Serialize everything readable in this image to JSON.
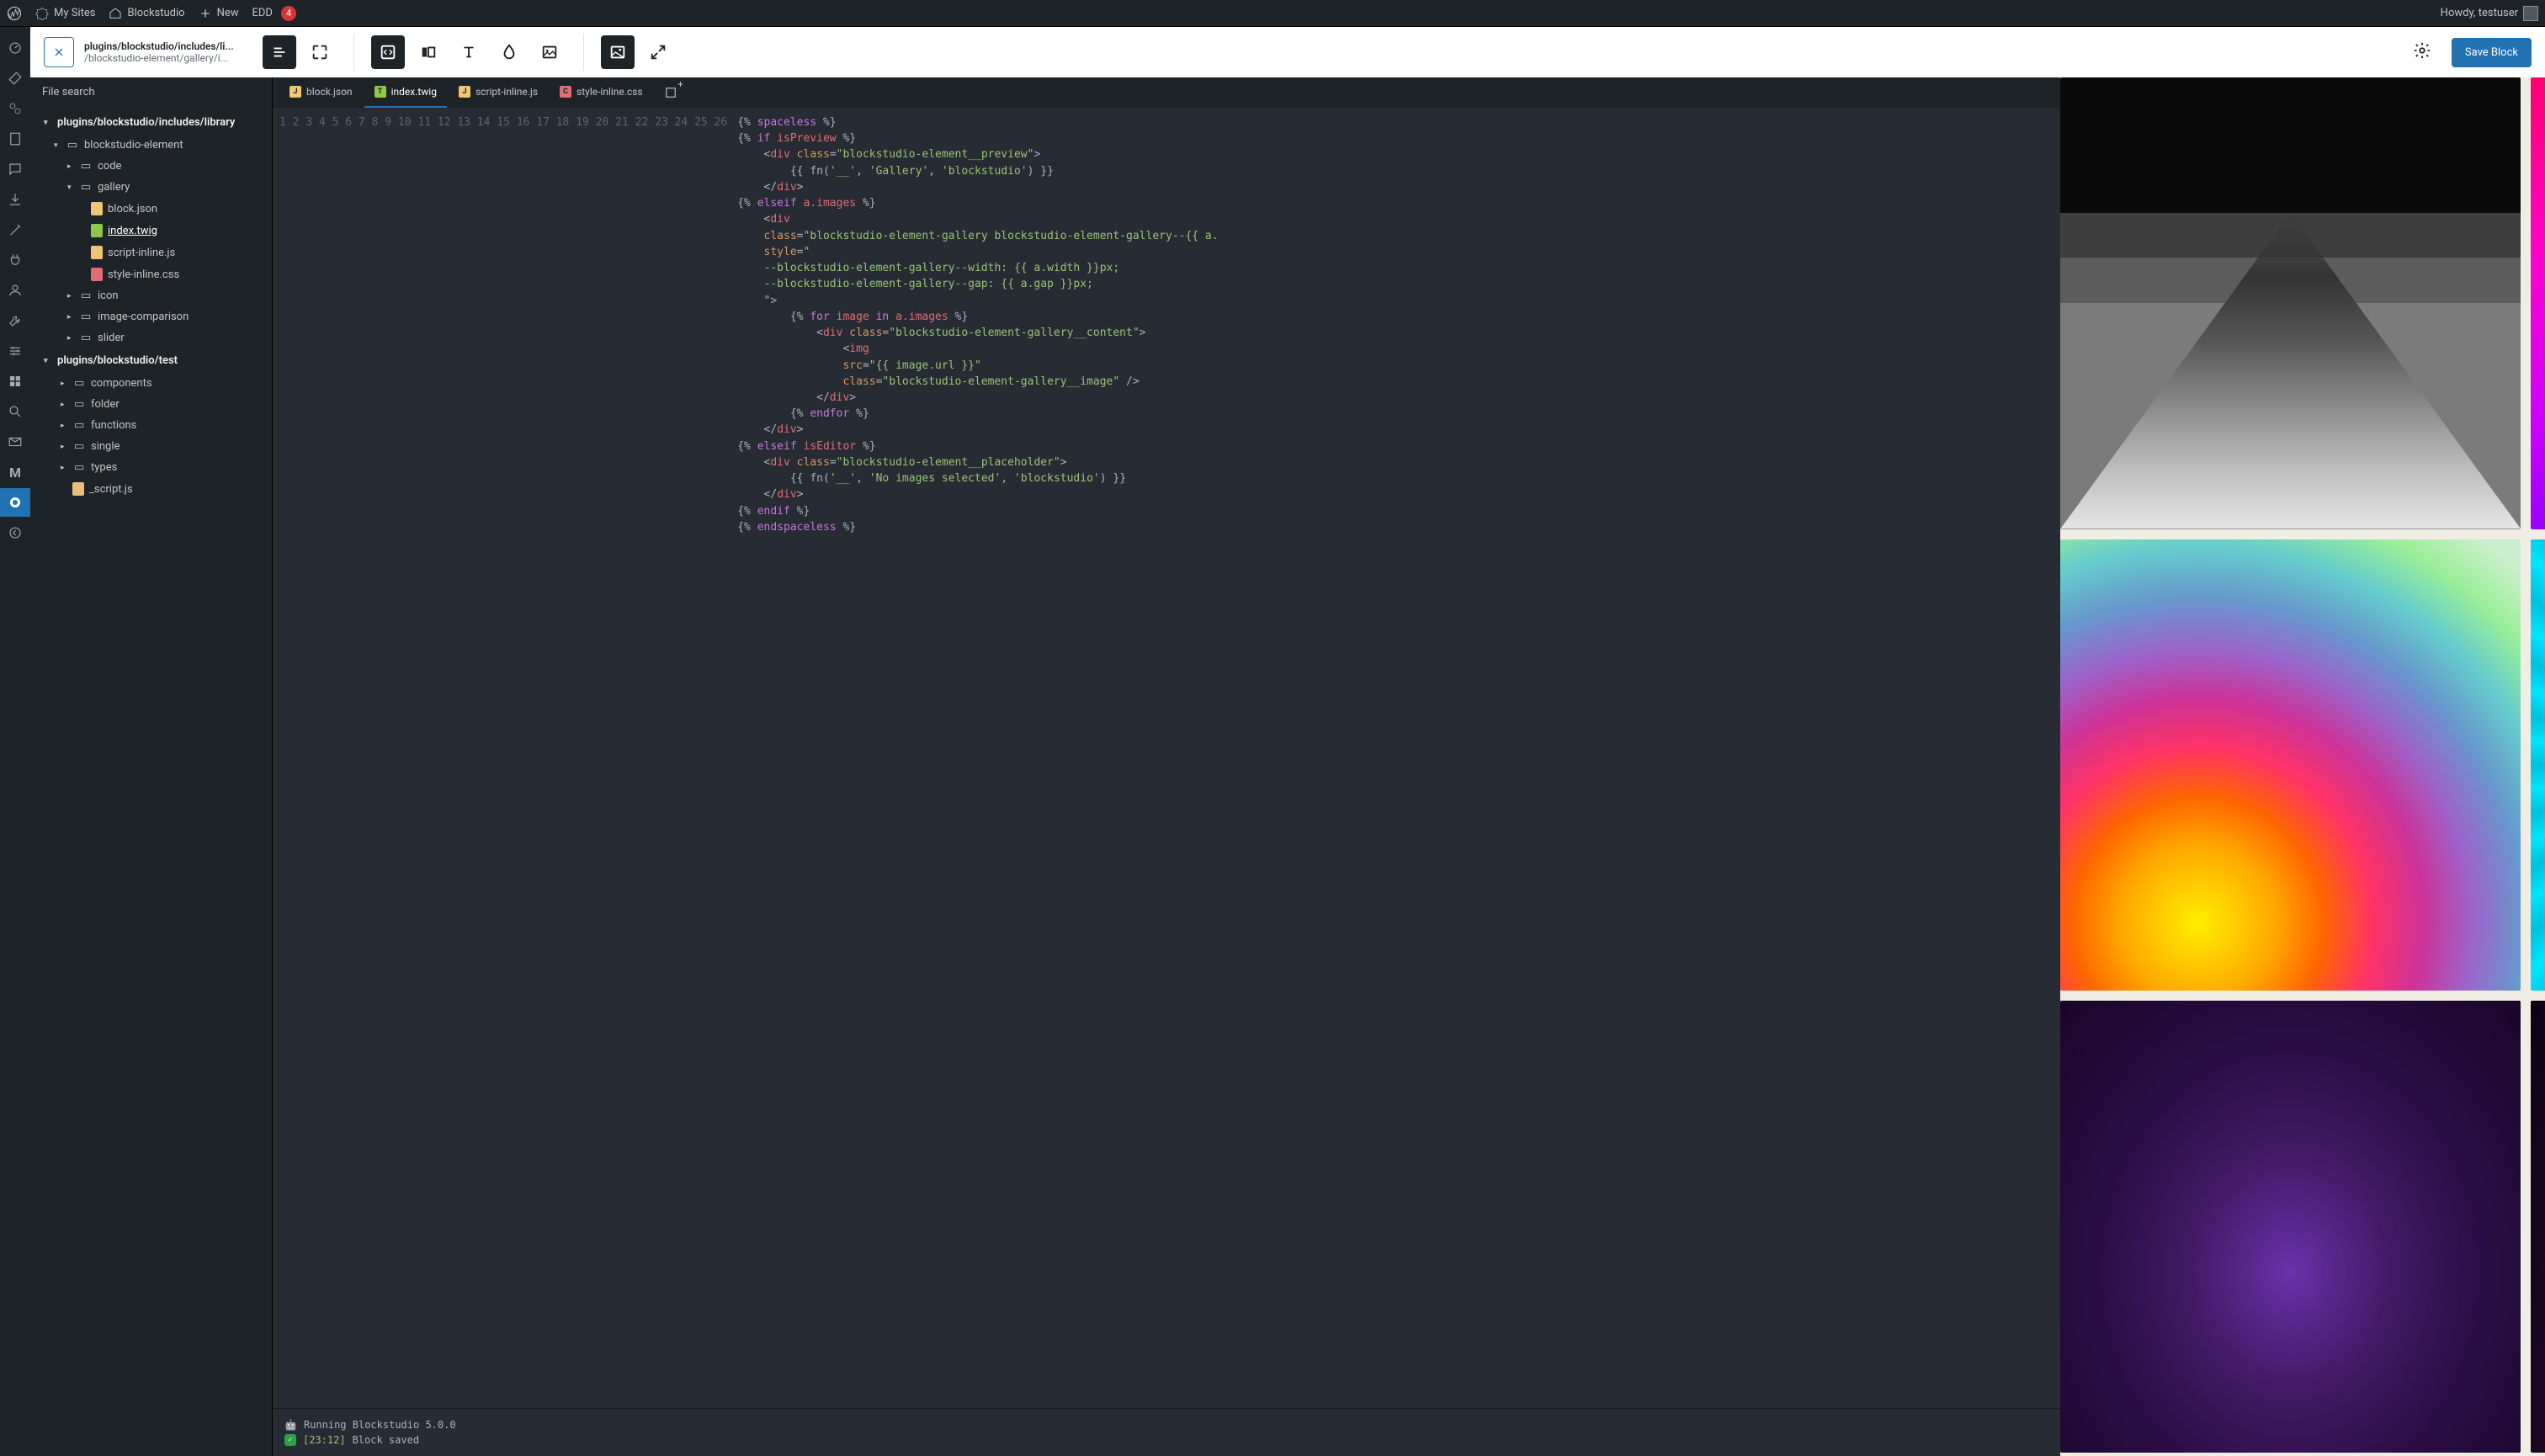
{
  "admin_bar": {
    "my_sites": "My Sites",
    "site_name": "Blockstudio",
    "new": "New",
    "edd": "EDD",
    "edd_count": "4",
    "howdy": "Howdy, testuser"
  },
  "toolbar": {
    "breadcrumb_line1": "plugins/blockstudio/includes/li...",
    "breadcrumb_line2": "/blockstudio-element/gallery/i...",
    "save_label": "Save Block"
  },
  "file_panel": {
    "search_placeholder": "File search",
    "section1": "plugins/blockstudio/includes/library",
    "section2": "plugins/blockstudio/test",
    "folders": {
      "element": "blockstudio-element",
      "code": "code",
      "gallery": "gallery",
      "icon": "icon",
      "image_comparison": "image-comparison",
      "slider": "slider",
      "components": "components",
      "folder": "folder",
      "functions": "functions",
      "single": "single",
      "types": "types"
    },
    "files": {
      "block_json": "block.json",
      "index_twig": "index.twig",
      "script_inline": "script-inline.js",
      "style_inline": "style-inline.css",
      "script_js": "_script.js"
    }
  },
  "tabs": {
    "block_json": "block.json",
    "index_twig": "index.twig",
    "script_inline": "script-inline.js",
    "style_inline": "style-inline.css"
  },
  "code_lines": [
    "1",
    "2",
    "3",
    "4",
    "5",
    "6",
    "7",
    "8",
    "9",
    "10",
    "11",
    "12",
    "13",
    "14",
    "15",
    "16",
    "17",
    "18",
    "19",
    "20",
    "21",
    "22",
    "23",
    "24",
    "25",
    "26"
  ],
  "console": {
    "line1": "Running Blockstudio 5.0.0",
    "line2_ts": "[23:12]",
    "line2_msg": "Block saved"
  }
}
